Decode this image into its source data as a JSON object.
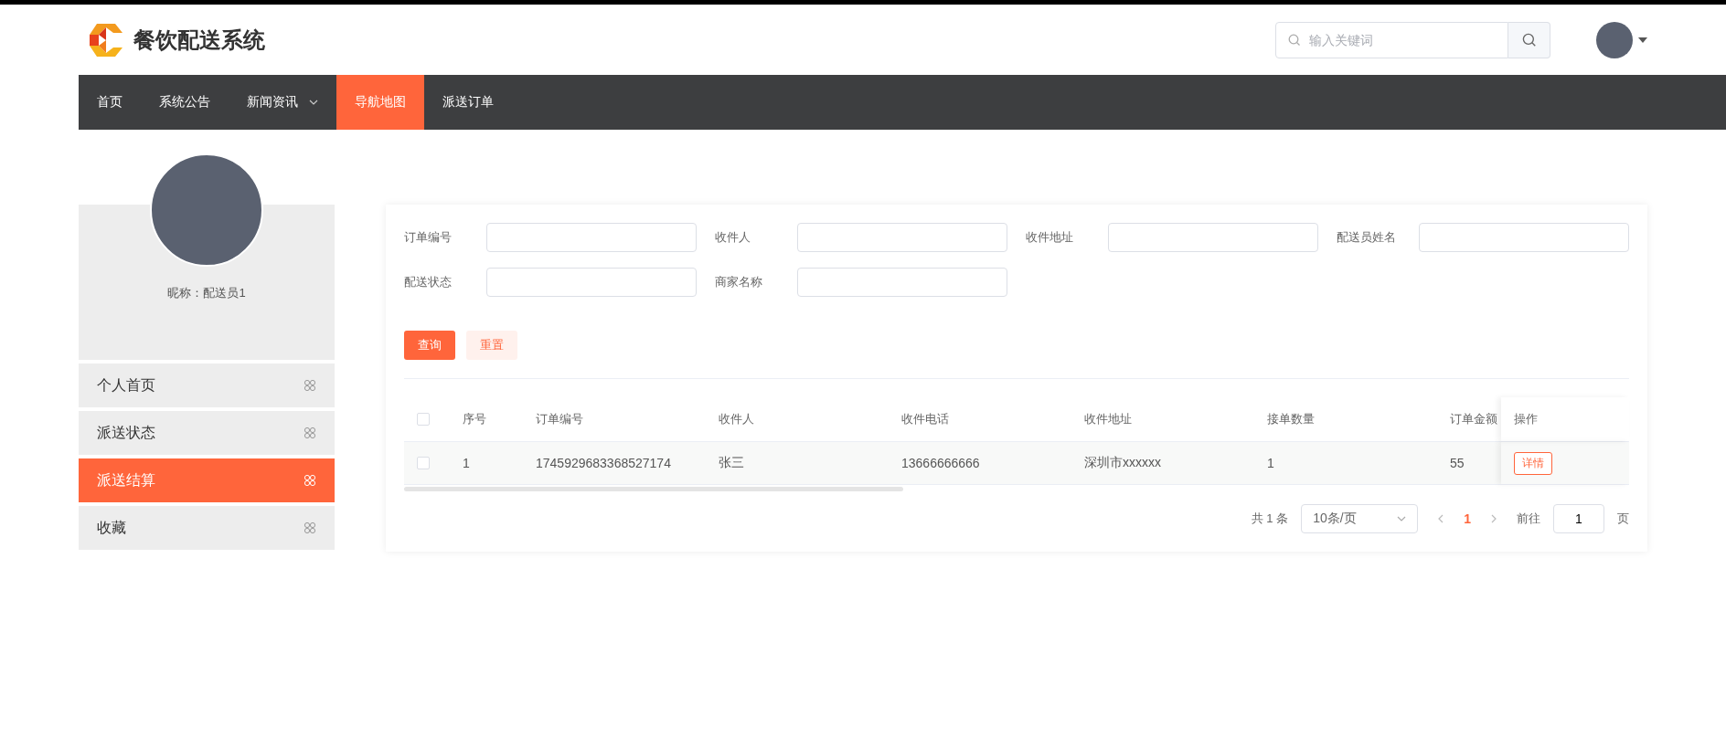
{
  "header": {
    "title": "餐饮配送系统",
    "search": {
      "placeholder": "输入关键词"
    }
  },
  "nav": [
    {
      "label": "首页",
      "selected": false,
      "has_dropdown": false
    },
    {
      "label": "系统公告",
      "selected": false,
      "has_dropdown": false
    },
    {
      "label": "新闻资讯",
      "selected": false,
      "has_dropdown": true
    },
    {
      "label": "导航地图",
      "selected": true,
      "has_dropdown": false
    },
    {
      "label": "派送订单",
      "selected": false,
      "has_dropdown": false
    }
  ],
  "profile": {
    "nickname": "昵称：配送员1"
  },
  "sidebar": {
    "items": [
      {
        "label": "个人首页",
        "selected": false
      },
      {
        "label": "派送状态",
        "selected": false
      },
      {
        "label": "派送结算",
        "selected": true
      },
      {
        "label": "收藏",
        "selected": false
      }
    ]
  },
  "filters": [
    {
      "label": "订单编号"
    },
    {
      "label": "收件人"
    },
    {
      "label": "收件地址"
    },
    {
      "label": "配送员姓名"
    },
    {
      "label": "配送状态"
    },
    {
      "label": "商家名称"
    }
  ],
  "buttons": [
    {
      "label": "查询",
      "kind": "primary"
    },
    {
      "label": "重置",
      "kind": "secondary"
    }
  ],
  "table": {
    "header_checked": false,
    "columns": [
      "序号",
      "订单编号",
      "收件人",
      "收件电话",
      "收件地址",
      "接单数量",
      "订单金额",
      "操作"
    ],
    "rows": [
      {
        "checked": false,
        "cells": [
          "1",
          "1745929683368527174",
          "张三",
          "13666666666",
          "深圳市xxxxxx",
          "1",
          "55"
        ],
        "action": "详情"
      }
    ]
  },
  "pagination": {
    "total": "共 1 条",
    "page_size": "10条/页",
    "pages": [
      {
        "label": "1",
        "selected": true
      }
    ],
    "goto_label": "前往",
    "goto_value": "1",
    "unit": "页"
  }
}
